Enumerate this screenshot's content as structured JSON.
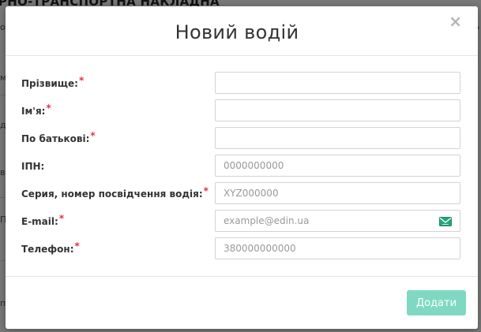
{
  "background": {
    "page_title": "АРНО-ТРАНСПОРТНА НАКЛАДНА",
    "fragments": [
      "о",
      "ми",
      "д",
      "в",
      "ПЛ",
      "п",
      "о"
    ]
  },
  "modal": {
    "title": "Новий водій",
    "close_symbol": "×",
    "required_mark": "*",
    "fields": [
      {
        "label": "Прізвище:",
        "required": true,
        "placeholder": "",
        "value": ""
      },
      {
        "label": "Ім'я:",
        "required": true,
        "placeholder": "",
        "value": ""
      },
      {
        "label": "По батькові:",
        "required": true,
        "placeholder": "",
        "value": ""
      },
      {
        "label": "ІПН:",
        "required": false,
        "placeholder": "0000000000",
        "value": ""
      },
      {
        "label": "Серия, номер посвідчення водія:",
        "required": true,
        "placeholder": "XYZ000000",
        "value": ""
      },
      {
        "label": "E-mail:",
        "required": true,
        "placeholder": "example@edin.ua",
        "value": "",
        "icon": "email-icon"
      },
      {
        "label": "Телефон:",
        "required": true,
        "placeholder": "380000000000",
        "value": ""
      }
    ],
    "submit_label": "Додати",
    "accent_color": "#7fd9c2",
    "required_color": "#e2314a"
  }
}
